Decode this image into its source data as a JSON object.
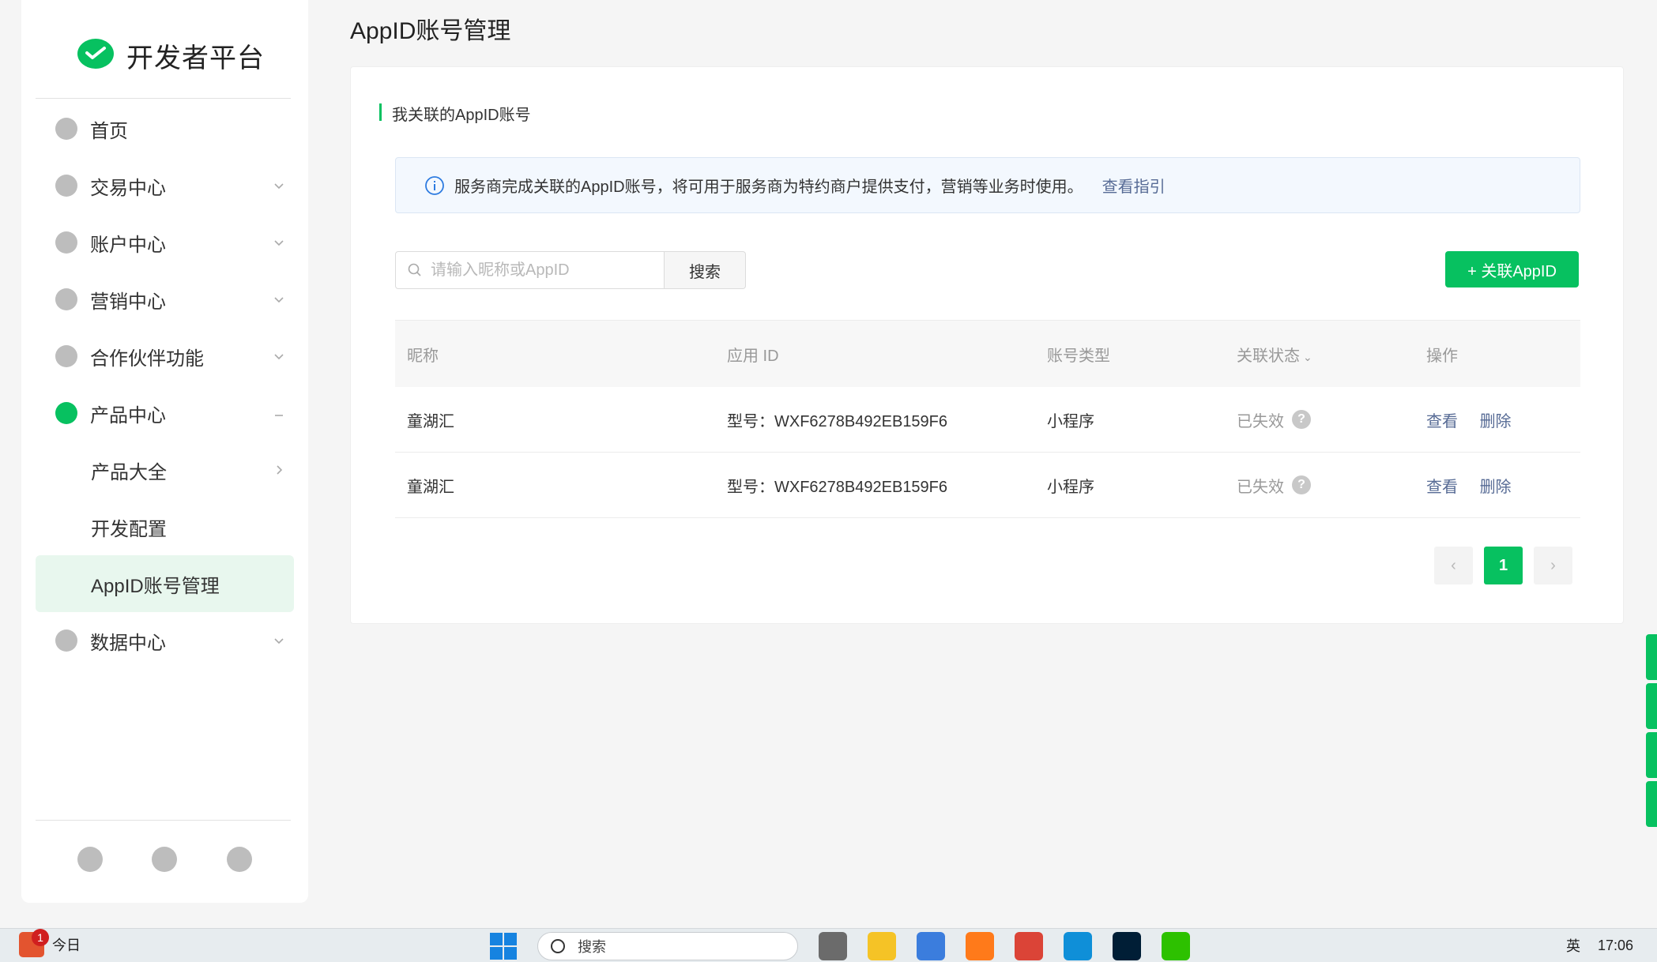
{
  "sidebar": {
    "brand": "开发者平台",
    "items": [
      {
        "label": "首页"
      },
      {
        "label": "交易中心"
      },
      {
        "label": "账户中心"
      },
      {
        "label": "营销中心"
      },
      {
        "label": "合作伙伴功能"
      },
      {
        "label": "产品中心"
      },
      {
        "label": "产品大全"
      },
      {
        "label": "开发配置"
      },
      {
        "label": "AppID账号管理"
      },
      {
        "label": "数据中心"
      }
    ]
  },
  "page": {
    "title": "AppID账号管理",
    "section_title": "我关联的AppID账号",
    "notice_text": "服务商完成关联的AppID账号，将可用于服务商为特约商户提供支付，营销等业务时使用。",
    "notice_link": "查看指引",
    "search_placeholder": "请输入昵称或AppID",
    "search_button": "搜索",
    "add_button": "+ 关联AppID"
  },
  "table": {
    "headers": [
      "昵称",
      "应用 ID",
      "账号类型",
      "关联状态",
      "操作"
    ],
    "rows": [
      {
        "nickname": "童湖汇",
        "app_id": "型号：WXF6278B492EB159F6",
        "type": "小程序",
        "status": "已失效",
        "view": "查看",
        "delete": "删除"
      },
      {
        "nickname": "童湖汇",
        "app_id": "型号：WXF6278B492EB159F6",
        "type": "小程序",
        "status": "已失效",
        "view": "查看",
        "delete": "删除"
      }
    ]
  },
  "pagination": {
    "current": "1",
    "prev": "‹",
    "next": "›"
  },
  "taskbar": {
    "news_badge": "1",
    "news_label": "今日",
    "search_label": "搜索",
    "ime": "英",
    "time": "17:06"
  },
  "colors": {
    "brand_green": "#07c160",
    "link_blue": "#576b95"
  }
}
